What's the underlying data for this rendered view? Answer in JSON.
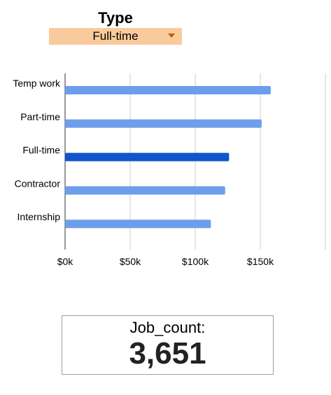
{
  "filter": {
    "title": "Type",
    "selected": "Full-time"
  },
  "colors": {
    "bar": "#6d9eeb",
    "bar_selected": "#1155cc",
    "dropdown": "#f9cb9c"
  },
  "chart_data": {
    "type": "bar",
    "orientation": "horizontal",
    "categories": [
      "Temp work",
      "Part-time",
      "Full-time",
      "Contractor",
      "Internship"
    ],
    "values": [
      158000,
      151000,
      126000,
      123000,
      112000
    ],
    "highlight": "Full-time",
    "xlim": [
      0,
      200000
    ],
    "xticks": [
      0,
      50000,
      100000,
      150000
    ],
    "xtick_labels": [
      "$0k",
      "$50k",
      "$100k",
      "$150k"
    ],
    "grid": true,
    "title": "",
    "xlabel": "",
    "ylabel": ""
  },
  "scorecard": {
    "label": "Job_count:",
    "value": "3,651"
  }
}
